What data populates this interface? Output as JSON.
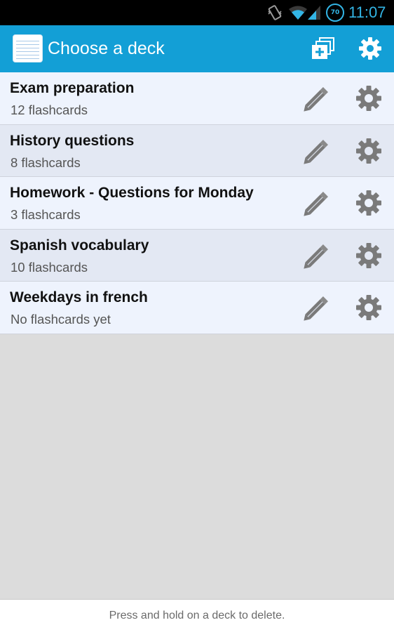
{
  "status_bar": {
    "time": "11:07",
    "battery_level": "70",
    "icons": [
      "vibrate-icon",
      "wifi-icon",
      "signal-icon",
      "battery-icon"
    ],
    "accent_color": "#33b5e5"
  },
  "action_bar": {
    "title": "Choose a deck",
    "background_color": "#139fd6",
    "actions": [
      {
        "name": "add-deck",
        "icon": "add-deck-icon"
      },
      {
        "name": "settings",
        "icon": "gear-icon"
      }
    ]
  },
  "decks": [
    {
      "name": "Exam preparation",
      "count": "12 flashcards"
    },
    {
      "name": "History questions",
      "count": "8 flashcards"
    },
    {
      "name": "Homework - Questions for Monday",
      "count": "3 flashcards"
    },
    {
      "name": "Spanish vocabulary",
      "count": "10 flashcards"
    },
    {
      "name": "Weekdays in french",
      "count": "No flashcards yet"
    }
  ],
  "footer": {
    "hint": "Press and hold on a deck to delete."
  }
}
